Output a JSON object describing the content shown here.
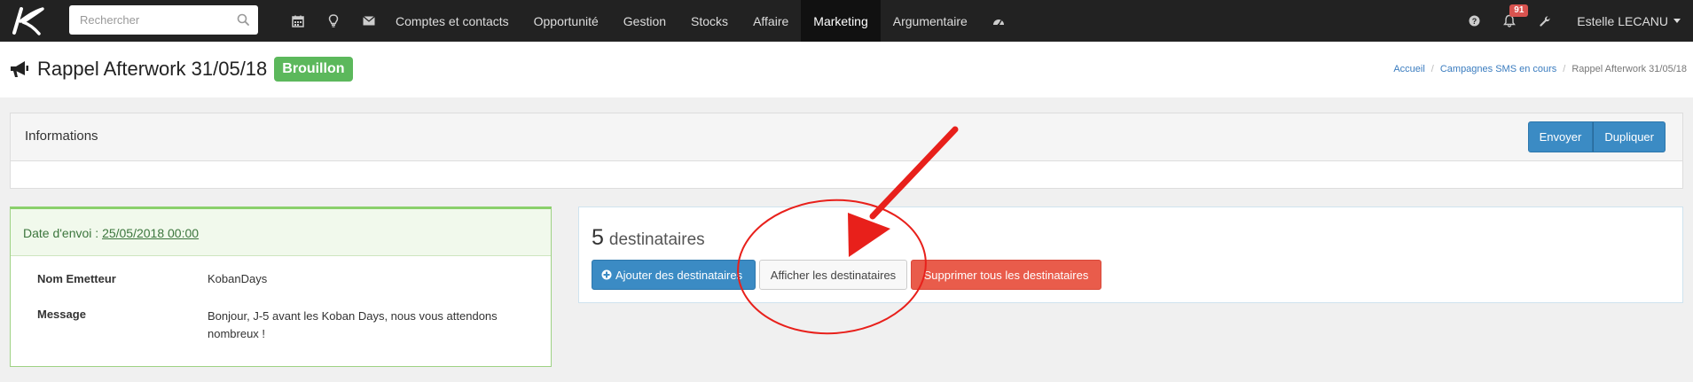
{
  "navbar": {
    "search_placeholder": "Rechercher",
    "icons": [
      "calendar-icon",
      "lightbulb-icon",
      "envelope-icon"
    ],
    "menu": [
      {
        "label": "Comptes et contacts"
      },
      {
        "label": "Opportunité"
      },
      {
        "label": "Gestion"
      },
      {
        "label": "Stocks"
      },
      {
        "label": "Affaire"
      },
      {
        "label": "Marketing",
        "active": true
      },
      {
        "label": "Argumentaire"
      }
    ],
    "dashboard_icon": "dashboard-icon",
    "notification_count": "91",
    "user_name": "Estelle LECANU"
  },
  "header": {
    "title": "Rappel Afterwork 31/05/18",
    "status": "Brouillon",
    "breadcrumb": [
      "Accueil",
      "Campagnes SMS en cours",
      "Rappel Afterwork 31/05/18"
    ]
  },
  "info_panel": {
    "title": "Informations",
    "send_label": "Envoyer",
    "duplicate_label": "Dupliquer"
  },
  "details": {
    "date_label": "Date d'envoi :",
    "date_value": "25/05/2018 00:00",
    "sender_label": "Nom Emetteur",
    "sender_value": "KobanDays",
    "message_label": "Message",
    "message_line1": "Bonjour, J-5 avant les Koban Days, nous vous attendons",
    "message_line2": "nombreux !"
  },
  "recipients": {
    "count": "5",
    "count_label": "destinataires",
    "add_label": "Ajouter des destinataires",
    "show_label": "Afficher les destinataires",
    "delete_label": "Supprimer tous les destinataires"
  },
  "colors": {
    "navbar_bg": "#222222",
    "status_green": "#5cb85c",
    "primary_blue": "#3b8bc4",
    "danger_red": "#e95c4b",
    "annotation_red": "#e8201b"
  }
}
